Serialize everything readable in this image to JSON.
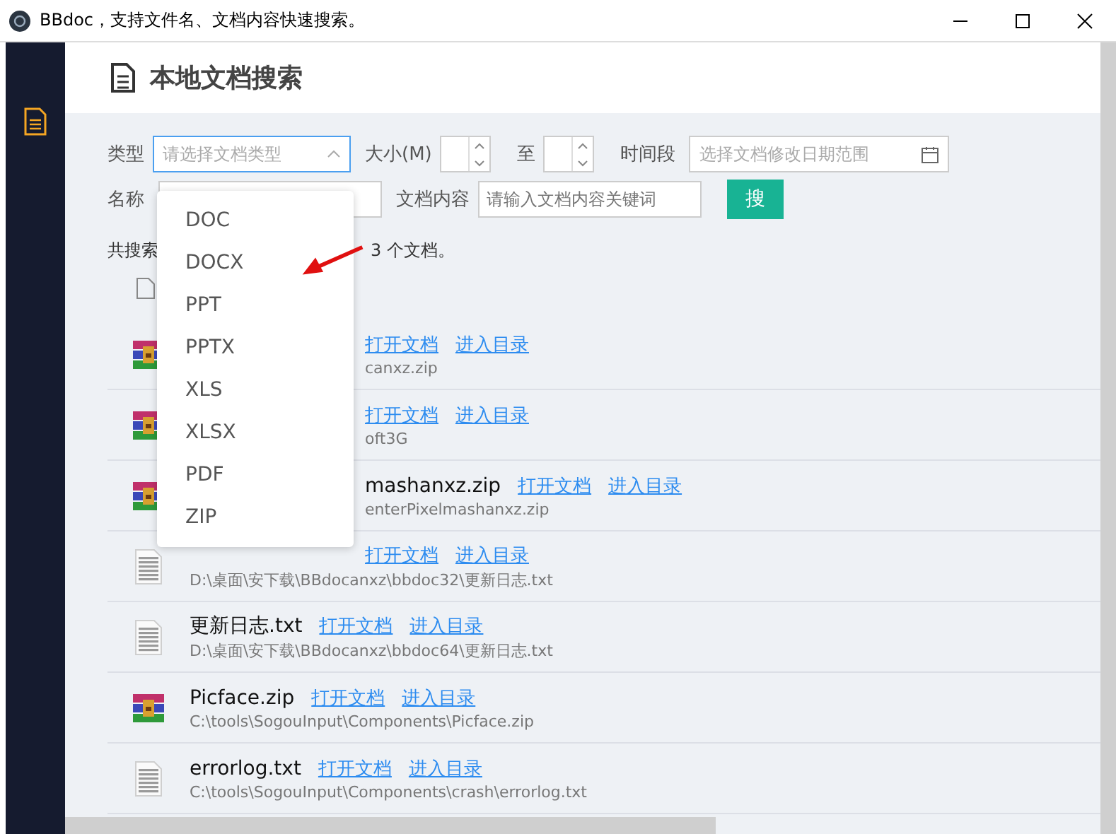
{
  "window": {
    "title": "BBdoc，支持文件名、文档内容快速搜索。"
  },
  "page": {
    "title": "本地文档搜索"
  },
  "form": {
    "type_label": "类型",
    "type_placeholder": "请选择文档类型",
    "size_label": "大小(M)",
    "size_to": "至",
    "period_label": "时间段",
    "period_placeholder": "选择文档修改日期范围",
    "name_label": "名称",
    "content_label": "文档内容",
    "content_placeholder": "请输入文档内容关键词",
    "search_button": "搜"
  },
  "summary": {
    "prefix": "共搜索",
    "suffix": "3 个文档。"
  },
  "dropdown": {
    "expanded": true,
    "options": [
      "DOC",
      "DOCX",
      "PPT",
      "PPTX",
      "XLS",
      "XLSX",
      "PDF",
      "ZIP"
    ]
  },
  "results": [
    {
      "kind": "archive",
      "open": "打开文档",
      "folder": "进入目录",
      "path": "canxz.zip"
    },
    {
      "kind": "archive",
      "open": "打开文档",
      "folder": "进入目录",
      "path": "oft3G"
    },
    {
      "kind": "archive",
      "name": "mashanxz.zip",
      "open": "打开文档",
      "folder": "进入目录",
      "path": "enterPixelmashanxz.zip"
    },
    {
      "kind": "text",
      "open": "打开文档",
      "folder": "进入目录",
      "path": "D:\\桌面\\安下载\\BBdocanxz\\bbdoc32\\更新日志.txt"
    },
    {
      "kind": "text",
      "name": "更新日志.txt",
      "open": "打开文档",
      "folder": "进入目录",
      "path": "D:\\桌面\\安下载\\BBdocanxz\\bbdoc64\\更新日志.txt"
    },
    {
      "kind": "archive",
      "name": "Picface.zip",
      "open": "打开文档",
      "folder": "进入目录",
      "path": "C:\\tools\\SogouInput\\Components\\Picface.zip"
    },
    {
      "kind": "text",
      "name": "errorlog.txt",
      "open": "打开文档",
      "folder": "进入目录",
      "path": "C:\\tools\\SogouInput\\Components\\crash\\errorlog.txt"
    }
  ]
}
